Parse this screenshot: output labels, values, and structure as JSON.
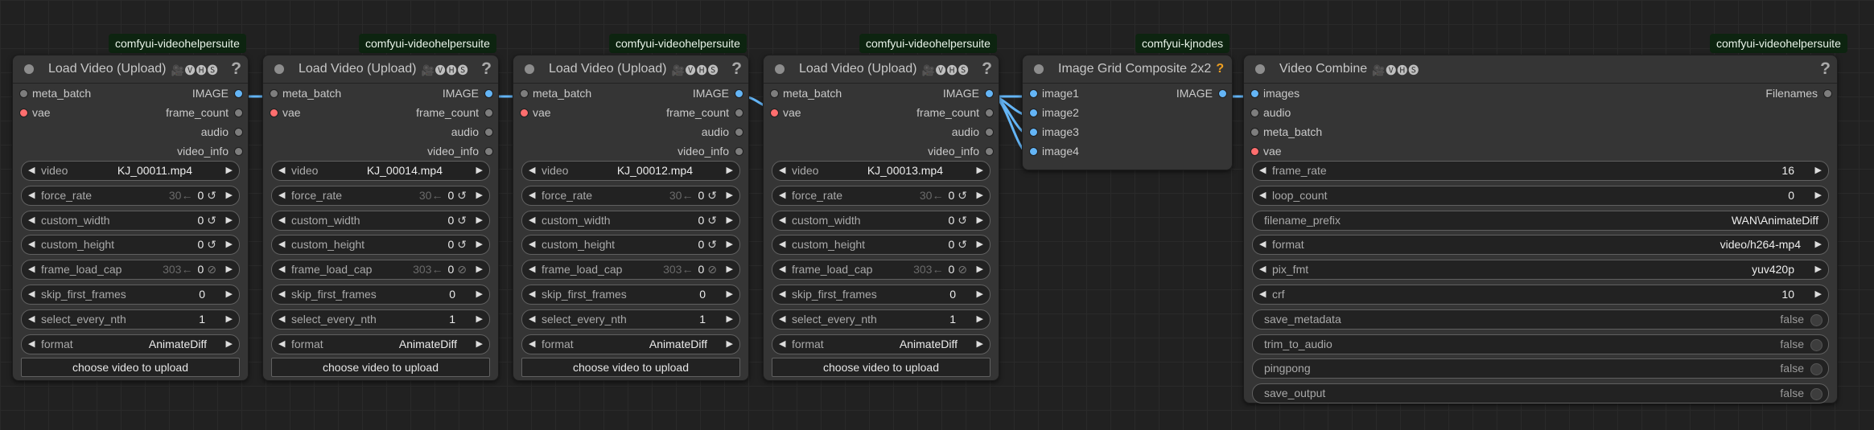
{
  "loaders": [
    {
      "badge": "comfyui-videohelpersuite",
      "title": "Load Video (Upload)",
      "icons": "🎥🅥🅗🅢",
      "help": "?",
      "inputs": [
        "meta_batch",
        "vae"
      ],
      "outputs": [
        "IMAGE",
        "frame_count",
        "audio",
        "video_info"
      ],
      "widgets": {
        "video": {
          "label": "video",
          "value": "KJ_00011.mp4"
        },
        "force_rate": {
          "label": "force_rate",
          "hint": "30←",
          "value": "0",
          "sym": "↺"
        },
        "custom_width": {
          "label": "custom_width",
          "value": "0",
          "sym": "↺"
        },
        "custom_height": {
          "label": "custom_height",
          "value": "0",
          "sym": "↺"
        },
        "frame_load_cap": {
          "label": "frame_load_cap",
          "hint": "303←",
          "value": "0",
          "sym": "⊘"
        },
        "skip_first_frames": {
          "label": "skip_first_frames",
          "value": "0"
        },
        "select_every_nth": {
          "label": "select_every_nth",
          "value": "1"
        },
        "format": {
          "label": "format",
          "value": "AnimateDiff"
        }
      },
      "button": "choose video to upload"
    },
    {
      "badge": "comfyui-videohelpersuite",
      "title": "Load Video (Upload)",
      "icons": "🎥🅥🅗🅢",
      "help": "?",
      "inputs": [
        "meta_batch",
        "vae"
      ],
      "outputs": [
        "IMAGE",
        "frame_count",
        "audio",
        "video_info"
      ],
      "widgets": {
        "video": {
          "label": "video",
          "value": "KJ_00014.mp4"
        },
        "force_rate": {
          "label": "force_rate",
          "hint": "30←",
          "value": "0",
          "sym": "↺"
        },
        "custom_width": {
          "label": "custom_width",
          "value": "0",
          "sym": "↺"
        },
        "custom_height": {
          "label": "custom_height",
          "value": "0",
          "sym": "↺"
        },
        "frame_load_cap": {
          "label": "frame_load_cap",
          "hint": "303←",
          "value": "0",
          "sym": "⊘"
        },
        "skip_first_frames": {
          "label": "skip_first_frames",
          "value": "0"
        },
        "select_every_nth": {
          "label": "select_every_nth",
          "value": "1"
        },
        "format": {
          "label": "format",
          "value": "AnimateDiff"
        }
      },
      "button": "choose video to upload"
    },
    {
      "badge": "comfyui-videohelpersuite",
      "title": "Load Video (Upload)",
      "icons": "🎥🅥🅗🅢",
      "help": "?",
      "inputs": [
        "meta_batch",
        "vae"
      ],
      "outputs": [
        "IMAGE",
        "frame_count",
        "audio",
        "video_info"
      ],
      "widgets": {
        "video": {
          "label": "video",
          "value": "KJ_00012.mp4"
        },
        "force_rate": {
          "label": "force_rate",
          "hint": "30←",
          "value": "0",
          "sym": "↺"
        },
        "custom_width": {
          "label": "custom_width",
          "value": "0",
          "sym": "↺"
        },
        "custom_height": {
          "label": "custom_height",
          "value": "0",
          "sym": "↺"
        },
        "frame_load_cap": {
          "label": "frame_load_cap",
          "hint": "303←",
          "value": "0",
          "sym": "⊘"
        },
        "skip_first_frames": {
          "label": "skip_first_frames",
          "value": "0"
        },
        "select_every_nth": {
          "label": "select_every_nth",
          "value": "1"
        },
        "format": {
          "label": "format",
          "value": "AnimateDiff"
        }
      },
      "button": "choose video to upload"
    },
    {
      "badge": "comfyui-videohelpersuite",
      "title": "Load Video (Upload)",
      "icons": "🎥🅥🅗🅢",
      "help": "?",
      "inputs": [
        "meta_batch",
        "vae"
      ],
      "outputs": [
        "IMAGE",
        "frame_count",
        "audio",
        "video_info"
      ],
      "widgets": {
        "video": {
          "label": "video",
          "value": "KJ_00013.mp4"
        },
        "force_rate": {
          "label": "force_rate",
          "hint": "30←",
          "value": "0",
          "sym": "↺"
        },
        "custom_width": {
          "label": "custom_width",
          "value": "0",
          "sym": "↺"
        },
        "custom_height": {
          "label": "custom_height",
          "value": "0",
          "sym": "↺"
        },
        "frame_load_cap": {
          "label": "frame_load_cap",
          "hint": "303←",
          "value": "0",
          "sym": "⊘"
        },
        "skip_first_frames": {
          "label": "skip_first_frames",
          "value": "0"
        },
        "select_every_nth": {
          "label": "select_every_nth",
          "value": "1"
        },
        "format": {
          "label": "format",
          "value": "AnimateDiff"
        }
      },
      "button": "choose video to upload"
    }
  ],
  "grid": {
    "badge": "comfyui-kjnodes",
    "title": "Image Grid Composite 2x2",
    "help": "?",
    "inputs": [
      "image1",
      "image2",
      "image3",
      "image4"
    ],
    "output": "IMAGE"
  },
  "combine": {
    "badge": "comfyui-videohelpersuite",
    "title": "Video Combine",
    "icons": "🎥🅥🅗🅢",
    "help": "?",
    "inputs": [
      "images",
      "audio",
      "meta_batch",
      "vae"
    ],
    "output": "Filenames",
    "widgets": {
      "frame_rate": {
        "label": "frame_rate",
        "value": "16"
      },
      "loop_count": {
        "label": "loop_count",
        "value": "0"
      },
      "filename_prefix": {
        "label": "filename_prefix",
        "value": "WAN\\AnimateDiff"
      },
      "format": {
        "label": "format",
        "value": "video/h264-mp4"
      },
      "pix_fmt": {
        "label": "pix_fmt",
        "value": "yuv420p"
      },
      "crf": {
        "label": "crf",
        "value": "10"
      },
      "save_metadata": {
        "label": "save_metadata",
        "value": "false"
      },
      "trim_to_audio": {
        "label": "trim_to_audio",
        "value": "false"
      },
      "pingpong": {
        "label": "pingpong",
        "value": "false"
      },
      "save_output": {
        "label": "save_output",
        "value": "false"
      }
    }
  },
  "colors": {
    "canvas": "#212121",
    "node": "#353535",
    "image_slot": "#64b5f6",
    "vae_slot": "#ff6e6e",
    "link": "#64b5f6",
    "badge": "#0d2410"
  }
}
